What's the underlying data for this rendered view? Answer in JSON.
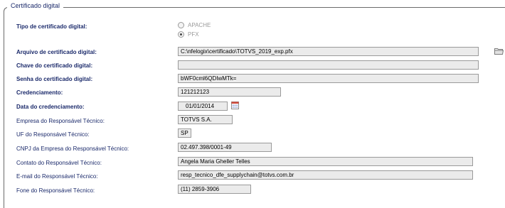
{
  "section": {
    "legend": "Certificado digital"
  },
  "tipo": {
    "label": "Tipo de certificado digital:",
    "options": [
      {
        "label": "APACHE",
        "selected": false
      },
      {
        "label": "PFX",
        "selected": true
      }
    ]
  },
  "arquivo": {
    "label": "Arquivo de certificado digital:",
    "value": "C:\\nfelogix\\certificado\\TOTVS_2019_exp.pfx",
    "icon": "folder-icon"
  },
  "chave": {
    "label": "Chave do certificado digital:",
    "value": ""
  },
  "senha": {
    "label": "Senha do certificado digital:",
    "value": "bWF0cml6QDIwMTk="
  },
  "credenciamento": {
    "label": "Credenciamento:",
    "value": "121212123"
  },
  "data_credenciamento": {
    "label": "Data do credenciamento:",
    "value": "01/01/2014",
    "icon": "calendar-icon"
  },
  "empresa": {
    "label": "Empresa do Responsável Técnico:",
    "value": "TOTVS S.A."
  },
  "uf": {
    "label": "UF do Responsável Técnico:",
    "value": "SP"
  },
  "cnpj": {
    "label": "CNPJ da Empresa do Responsável Técnico:",
    "value": "02.497.398/0001-49"
  },
  "contato": {
    "label": "Contato do Responsável Técnico:",
    "value": "Angela Maria Gheller Telles"
  },
  "email": {
    "label": "E-mail do Responsável Técnico:",
    "value": "resp_tecnico_dfe_supplychain@totvs.com.br"
  },
  "fone": {
    "label": "Fone do Responsável Técnico:",
    "value": "(11) 2859-3906"
  }
}
